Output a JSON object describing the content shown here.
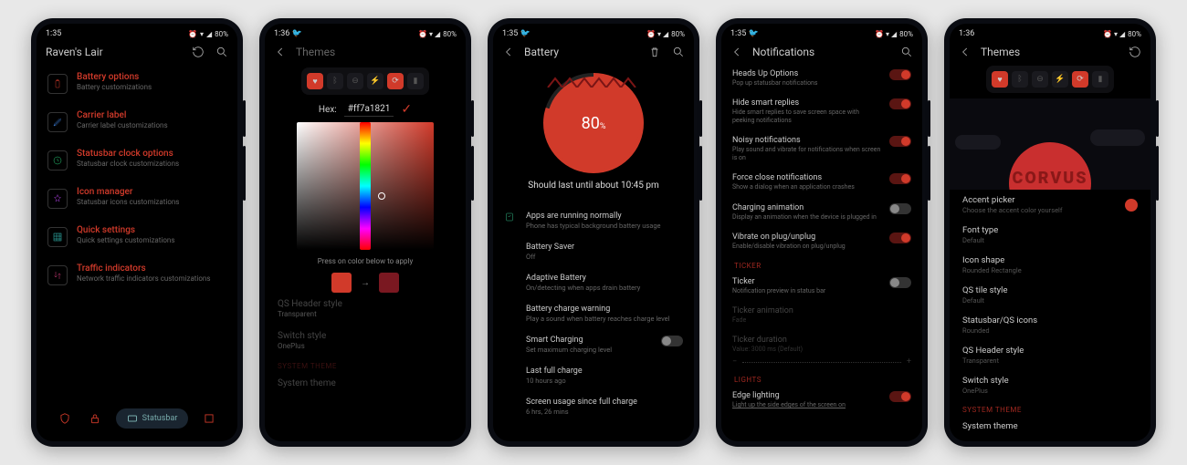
{
  "status": {
    "time": "1:35",
    "time2": "1:36",
    "battery": "80%"
  },
  "p1": {
    "title": "Raven's Lair",
    "items": [
      {
        "t": "Battery options",
        "s": "Battery customizations"
      },
      {
        "t": "Carrier label",
        "s": "Carrier label customizations"
      },
      {
        "t": "Statusbar clock options",
        "s": "Statusbar clock customizations"
      },
      {
        "t": "Icon manager",
        "s": "Statusbar icons customizations"
      },
      {
        "t": "Quick settings",
        "s": "Quick settings customizations"
      },
      {
        "t": "Traffic indicators",
        "s": "Network traffic indicators customizations"
      }
    ],
    "tab_active": "Statusbar"
  },
  "p2": {
    "title": "Themes",
    "hex_label": "Hex:",
    "hex_value": "#ff7a1821",
    "apply_label": "Press on color below to apply",
    "swatch1": "#d13a2a",
    "swatch2": "#7a1821",
    "rows": [
      {
        "t": "QS Header style",
        "s": "Transparent"
      },
      {
        "t": "Switch style",
        "s": "OnePlus"
      }
    ],
    "section": "System Theme",
    "last": "System theme"
  },
  "p3": {
    "title": "Battery",
    "pct": "80",
    "pct_unit": "%",
    "msg": "Should last until about 10:45 pm",
    "apps_t": "Apps are running normally",
    "apps_s": "Phone has typical background battery usage",
    "rows": [
      {
        "t": "Battery Saver",
        "s": "Off"
      },
      {
        "t": "Adaptive Battery",
        "s": "On/detecting when apps drain battery"
      },
      {
        "t": "Battery charge warning",
        "s": "Play a sound when battery reaches charge level"
      },
      {
        "t": "Smart Charging",
        "s": "Set maximum charging level",
        "toggle": true
      },
      {
        "t": "Last full charge",
        "s": "10 hours ago"
      },
      {
        "t": "Screen usage since full charge",
        "s": "6 hrs, 26 mins"
      }
    ]
  },
  "p4": {
    "title": "Notifications",
    "rows": [
      {
        "t": "Heads Up Options",
        "s": "Pop up statusbar notifications",
        "on": true
      },
      {
        "t": "Hide smart replies",
        "s": "Hide smart replies to save screen space with peeking notifications",
        "on": true
      },
      {
        "t": "Noisy notifications",
        "s": "Play sound and vibrate for notifications when screen is on",
        "on": true
      },
      {
        "t": "Force close notifications",
        "s": "Show a dialog when an application crashes",
        "on": true
      },
      {
        "t": "Charging animation",
        "s": "Display an animation when the device is plugged in",
        "on": false
      },
      {
        "t": "Vibrate on plug/unplug",
        "s": "Enable/disable vibration on plug/unplug",
        "on": true
      }
    ],
    "ticker_head": "Ticker",
    "ticker": {
      "t": "Ticker",
      "s": "Notification preview in status bar"
    },
    "ticker_anim": {
      "t": "Ticker animation",
      "s": "Fade"
    },
    "ticker_dur": {
      "t": "Ticker duration",
      "s": "Value: 3000 ms (Default)"
    },
    "lights_head": "Lights",
    "edge": {
      "t": "Edge lighting",
      "s": "Light up the side edges of the screen on"
    }
  },
  "p5": {
    "title": "Themes",
    "brand": "CORVUS",
    "accent": {
      "t": "Accent picker",
      "s": "Choose the accent color yourself"
    },
    "rows": [
      {
        "t": "Font type",
        "s": "Default"
      },
      {
        "t": "Icon shape",
        "s": "Rounded Rectangle"
      },
      {
        "t": "QS tile style",
        "s": "Default"
      },
      {
        "t": "Statusbar/QS icons",
        "s": "Rounded"
      },
      {
        "t": "QS Header style",
        "s": "Transparent"
      },
      {
        "t": "Switch style",
        "s": "OnePlus"
      }
    ],
    "section": "System Theme",
    "last": "System theme"
  }
}
